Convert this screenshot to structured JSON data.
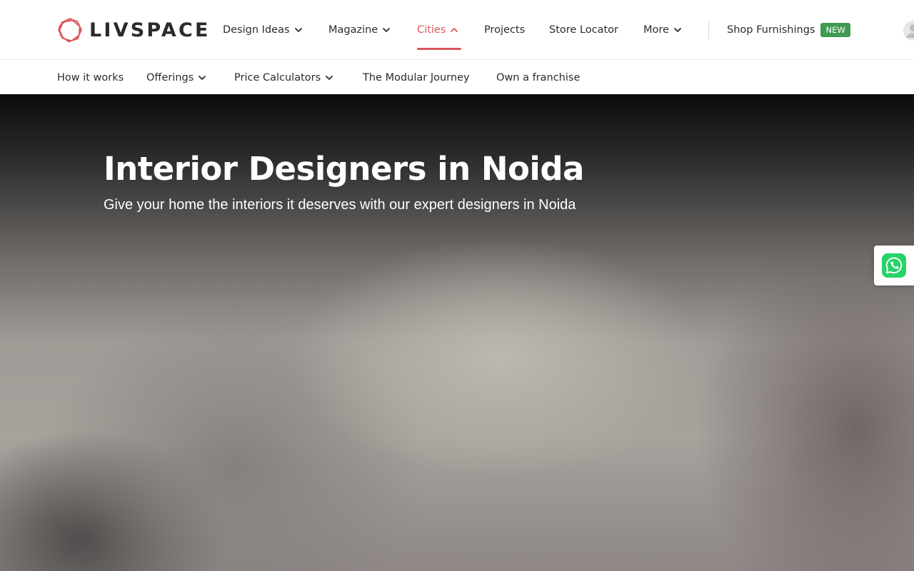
{
  "brand": {
    "name": "LIVSPACE",
    "accent_color": "#dc5659",
    "badge_color": "#3f9a52"
  },
  "top_nav": {
    "items": [
      {
        "label": "Design Ideas",
        "icon": "chevron-down-icon"
      },
      {
        "label": "Magazine",
        "icon": "chevron-down-icon"
      },
      {
        "label": "Cities",
        "icon": "chevron-up-icon",
        "active": true
      },
      {
        "label": "Projects"
      },
      {
        "label": "Store Locator"
      },
      {
        "label": "More",
        "icon": "chevron-down-icon"
      }
    ],
    "shop": {
      "label": "Shop Furnishings",
      "badge": "NEW"
    },
    "account_icon": "user-avatar-icon"
  },
  "sub_nav": {
    "items": [
      {
        "label": "How it works"
      },
      {
        "label": "Offerings",
        "icon": "chevron-down-icon"
      },
      {
        "label": "Price Calculators",
        "icon": "chevron-down-icon"
      },
      {
        "label": "The Modular Journey"
      },
      {
        "label": "Own a franchise"
      }
    ]
  },
  "hero": {
    "title": "Interior Designers in Noida",
    "subtitle": "Give your home the interiors it deserves with our expert designers in Noida"
  },
  "floating": {
    "whatsapp_icon": "whatsapp-icon"
  }
}
